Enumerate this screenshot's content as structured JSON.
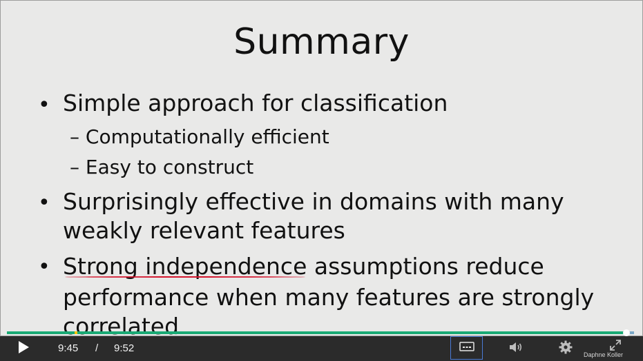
{
  "slide": {
    "title": "Summary",
    "bullets": [
      {
        "text": "Simple approach for classification",
        "sub": [
          "– Computationally efficient",
          "– Easy to construct"
        ]
      },
      {
        "line1": "Surprisingly effective in domains with many",
        "line2": "weakly relevant features"
      },
      {
        "underlined": "Strong independence",
        "rest": " assumptions reduce",
        "line2": "performance when many features are strongly",
        "line3": "correlated"
      }
    ],
    "bullet_glyph": "•",
    "watermark": "Daphne Koller"
  },
  "player": {
    "progress": 0.988,
    "current_time": "9:45",
    "separator": "/",
    "duration": "9:52",
    "icons": {
      "play": "play-icon",
      "captions": "captions-icon",
      "volume": "volume-icon",
      "settings": "gear-icon",
      "fullscreen": "fullscreen-icon"
    },
    "colors": {
      "progress_fill": "#19a974",
      "progress_track": "#7aa7c7",
      "controls_bg": "#2b2b2b",
      "underline": "#d4142c",
      "captions_border": "#4a7bd6"
    }
  }
}
